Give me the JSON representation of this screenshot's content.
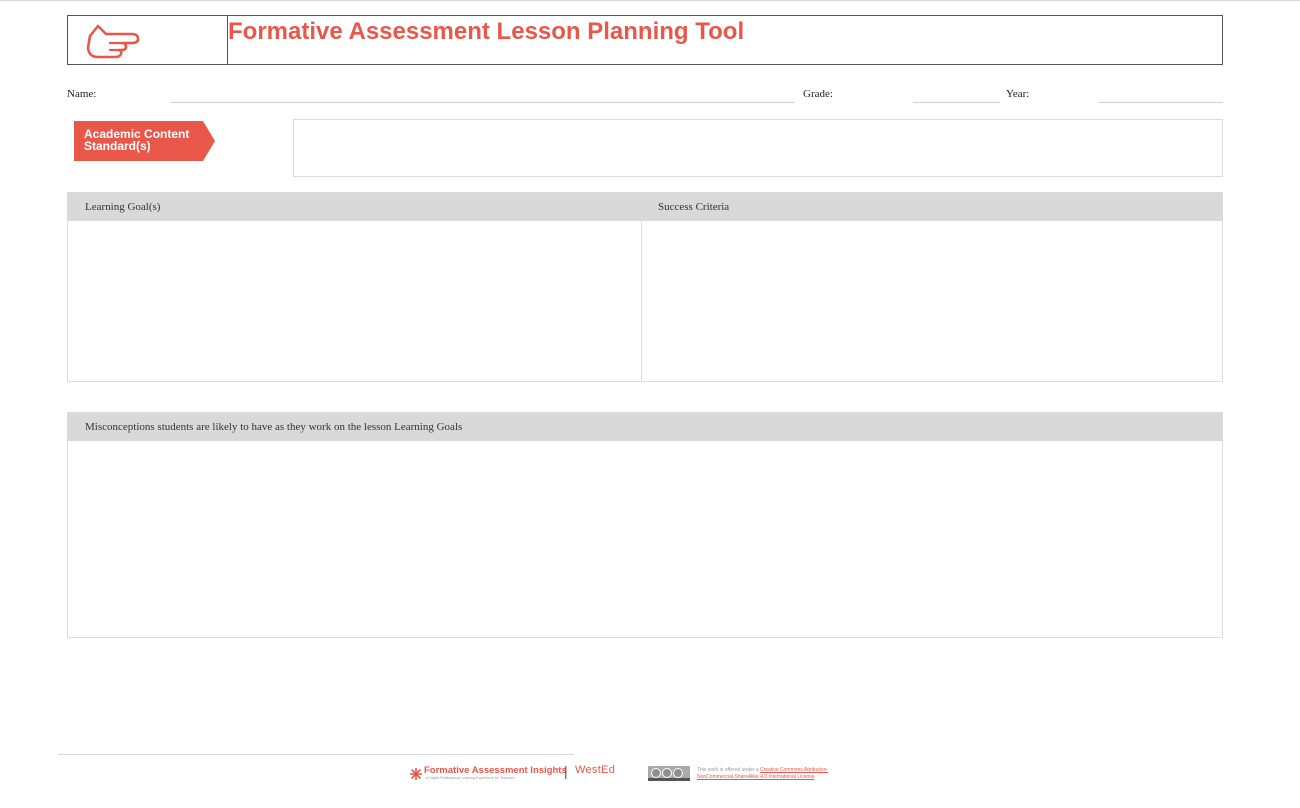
{
  "header": {
    "title": "Formative Assessment Lesson Planning Tool",
    "icon": "pointing-hand-icon",
    "accent_color": "#e8574a"
  },
  "fields": {
    "name_label": "Name:",
    "grade_label": "Grade:",
    "year_label": "Year:"
  },
  "standards": {
    "tag_label": "Academic Content Standard(s)"
  },
  "goals_panel": {
    "learning_goals_heading": "Learning Goal(s)",
    "success_criteria_heading": "Success Criteria"
  },
  "misconceptions_panel": {
    "heading": "Misconceptions students are likely to have as they work on the lesson Learning Goals"
  },
  "footer": {
    "brand_name": "Formative Assessment Insights",
    "brand_tagline": "A Digital Professional Learning Experience for Teachers",
    "separator": "|",
    "partner_logo": "WestEd",
    "license_prefix": "This work is offered under a",
    "license_link_line1": "Creative Commons Attribution-",
    "license_link_line2": "NonCommercial-ShareAlike 4.0 International License"
  }
}
